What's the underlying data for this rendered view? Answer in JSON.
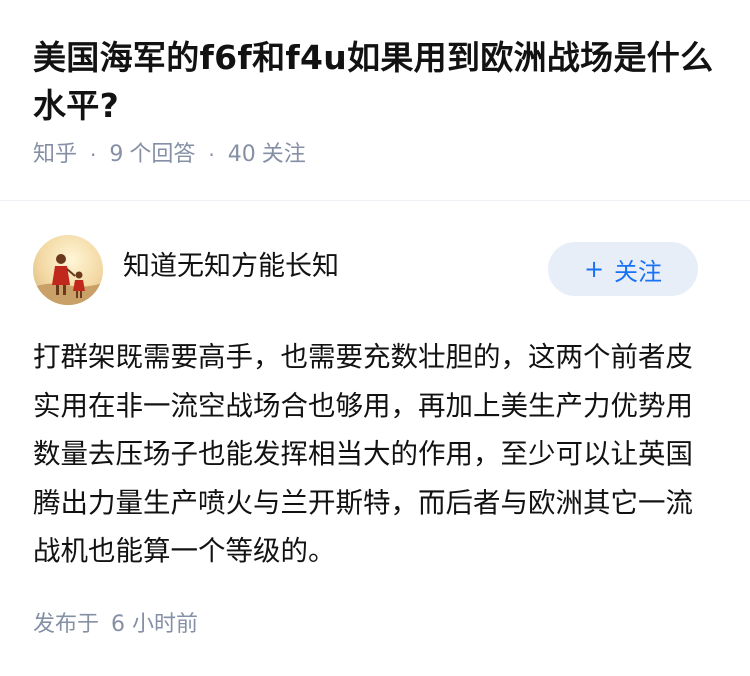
{
  "question": {
    "title": "美国海军的f6f和f4u如果用到欧洲战场是什么水平?",
    "source": "知乎",
    "answer_count": "9",
    "answer_label": "个回答",
    "follower_count": "40",
    "follower_label": "关注"
  },
  "answer": {
    "author_name": "知道无知方能长知",
    "follow_label": "关注",
    "content": "打群架既需要高手，也需要充数壮胆的，这两个前者皮实用在非一流空战场合也够用，再加上美生产力优势用数量去压场子也能发挥相当大的作用，至少可以让英国腾出力量生产喷火与兰开斯特，而后者与欧洲其它一流战机也能算一个等级的。",
    "published_label": "发布于",
    "published_time": "6 小时前"
  },
  "colors": {
    "accent": "#1772f6",
    "follow_bg": "#e8eef8",
    "meta_text": "#8590a6",
    "body_text": "#121212"
  },
  "icons": {
    "follow": "plus-icon",
    "avatar": "avatar-image"
  }
}
